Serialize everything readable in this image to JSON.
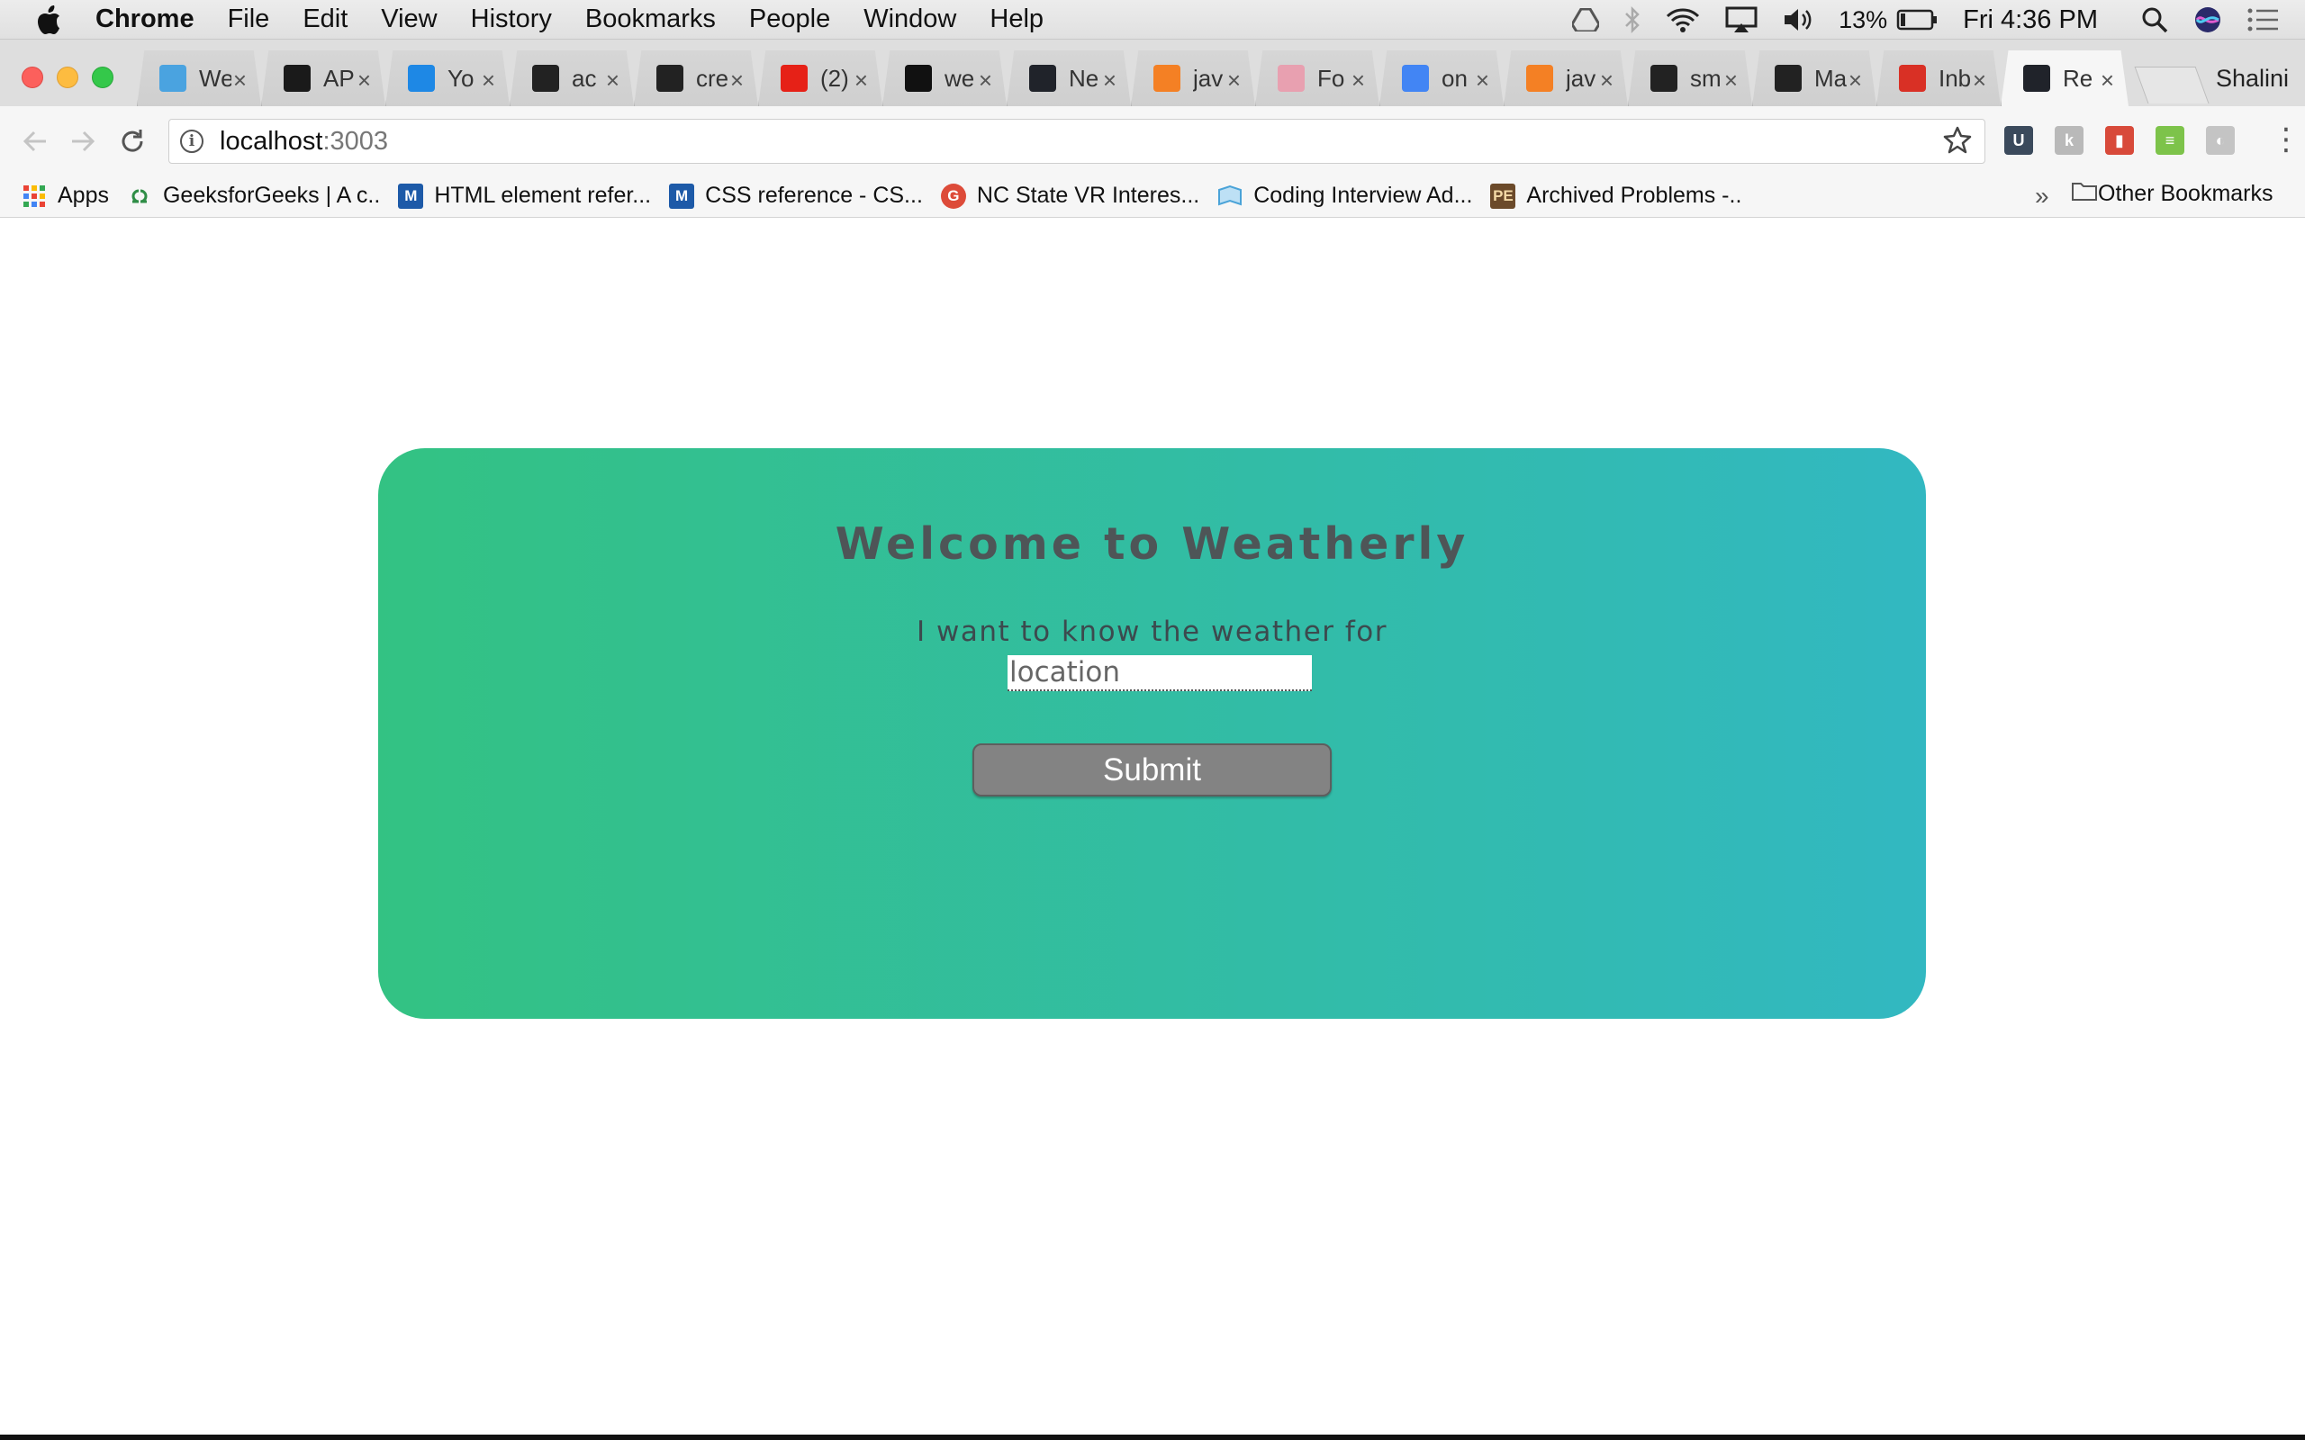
{
  "menubar": {
    "app_name": "Chrome",
    "menu_items": [
      "File",
      "Edit",
      "View",
      "History",
      "Bookmarks",
      "People",
      "Window",
      "Help"
    ],
    "battery_percent": "13%",
    "clock": "Fri 4:36 PM"
  },
  "tabs": [
    {
      "title": "We",
      "favicon": "gear-icon",
      "color": "#4aa3e0"
    },
    {
      "title": "AP",
      "favicon": "wunderground-icon",
      "color": "#1a1a1a"
    },
    {
      "title": "Yo",
      "favicon": "bar-chart-icon",
      "color": "#1e88e5"
    },
    {
      "title": "ac",
      "favicon": "github-icon",
      "color": "#222222"
    },
    {
      "title": "cre",
      "favicon": "github-icon",
      "color": "#222222"
    },
    {
      "title": "(2)",
      "favicon": "youtube-icon",
      "color": "#e62117"
    },
    {
      "title": "we",
      "favicon": "medium-icon",
      "color": "#111111"
    },
    {
      "title": "Ne",
      "favicon": "react-icon",
      "color": "#20232a"
    },
    {
      "title": "jav",
      "favicon": "stackoverflow-icon",
      "color": "#f48024"
    },
    {
      "title": "Fo",
      "favicon": "fontawesome-icon",
      "color": "#e8a0b0"
    },
    {
      "title": "on",
      "favicon": "google-icon",
      "color": "#4285f4"
    },
    {
      "title": "jav",
      "favicon": "stackoverflow-icon",
      "color": "#f48024"
    },
    {
      "title": "sm",
      "favicon": "github-icon",
      "color": "#222222"
    },
    {
      "title": "Ma",
      "favicon": "github-icon",
      "color": "#222222"
    },
    {
      "title": "Inb",
      "favicon": "gmail-icon",
      "color": "#d93025"
    },
    {
      "title": "Re",
      "favicon": "react-icon",
      "color": "#20232a",
      "active": true
    }
  ],
  "profile_name": "Shalini",
  "toolbar": {
    "url_host": "localhost",
    "url_port": ":3003"
  },
  "bookmarks": [
    {
      "label": "Apps",
      "icon": "apps-grid-icon"
    },
    {
      "label": "GeeksforGeeks | A c..",
      "icon": "geeksforgeeks-icon"
    },
    {
      "label": "HTML element refer...",
      "icon": "mdn-icon"
    },
    {
      "label": "CSS reference - CS...",
      "icon": "mdn-icon"
    },
    {
      "label": "NC State VR Interes...",
      "icon": "google-plus-icon"
    },
    {
      "label": "Coding Interview Ad...",
      "icon": "book-icon"
    },
    {
      "label": "Archived Problems -..",
      "icon": "project-euler-icon"
    }
  ],
  "bookmarks_overflow": "»",
  "other_bookmarks": "Other Bookmarks",
  "page": {
    "title": "Welcome to Weatherly",
    "prompt": "I want to know the weather for",
    "location_placeholder": "location",
    "location_value": "",
    "submit_label": "Submit",
    "card_gradient": [
      "#33c283",
      "#32b8c1"
    ],
    "button_color": "#838383"
  }
}
